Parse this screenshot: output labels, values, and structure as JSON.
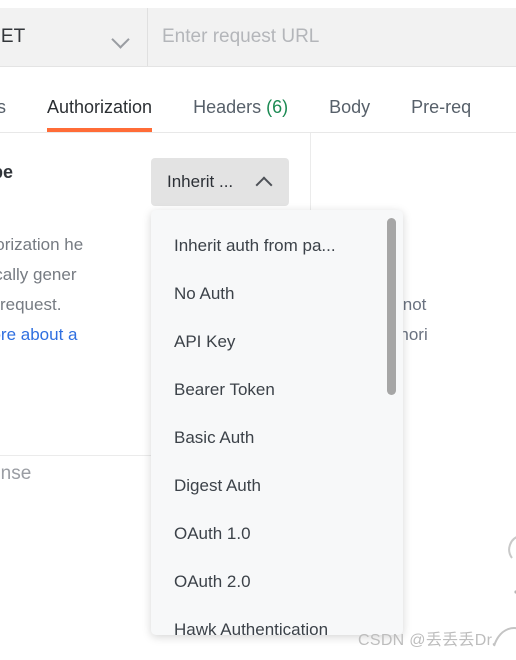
{
  "request_bar": {
    "method": "GET",
    "method_icon": "chevron-down-icon",
    "url_placeholder": "Enter request URL",
    "url_value": ""
  },
  "tabs": [
    {
      "label": "rams",
      "count": "",
      "active": false
    },
    {
      "label": "Authorization",
      "count": "",
      "active": true
    },
    {
      "label": "Headers",
      "count": "(6)",
      "active": false
    },
    {
      "label": "Body",
      "count": "",
      "active": false
    },
    {
      "label": "Pre-req",
      "count": "",
      "active": false
    }
  ],
  "auth_panel": {
    "type_label": "ype",
    "description_lines": [
      "e authorization he",
      "tomatically gener",
      "nd the request."
    ],
    "learn_more": "arn more about a",
    "right_note_lines": [
      "equest is not",
      "rent's authori"
    ]
  },
  "auth_select": {
    "selected_label": "Inherit ...",
    "caret_icon": "chevron-up-icon",
    "expanded": true,
    "options": [
      "Inherit auth from pa...",
      "No Auth",
      "API Key",
      "Bearer Token",
      "Basic Auth",
      "Digest Auth",
      "OAuth 1.0",
      "OAuth 2.0",
      "Hawk Authentication"
    ]
  },
  "response": {
    "label": "sponse"
  },
  "watermark": {
    "text": "CSDN @丢丢丢Dr."
  },
  "colors": {
    "accent": "#ff6c37",
    "count_green": "#1c8a53",
    "link_blue": "#2f6fe0",
    "bar_bg": "#f2f2f2",
    "menu_bg": "#f7f8f9",
    "trigger_bg": "#e3e3e3"
  }
}
